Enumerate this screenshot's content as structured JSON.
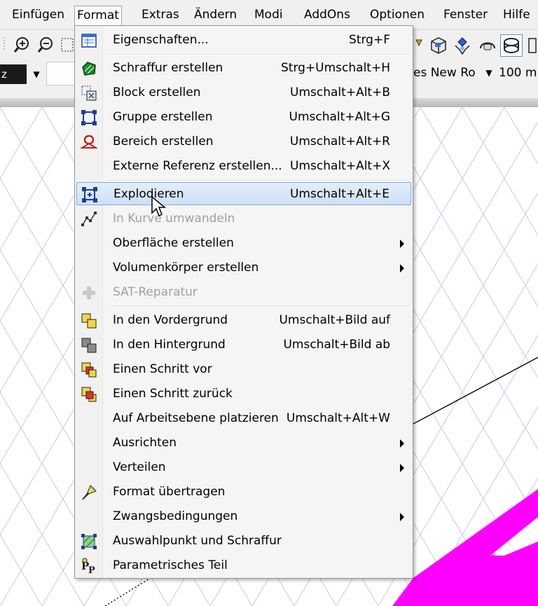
{
  "menubar": {
    "items": [
      {
        "label": "Einfügen",
        "active": false
      },
      {
        "label": "Format",
        "active": true
      },
      {
        "label": "Extras",
        "active": false
      },
      {
        "label": "Ändern",
        "active": false
      },
      {
        "label": "Modi",
        "active": false
      },
      {
        "label": "AddOns",
        "active": false
      },
      {
        "label": "Optionen",
        "active": false
      },
      {
        "label": "Fenster",
        "active": false
      },
      {
        "label": "Hilfe",
        "active": false
      }
    ]
  },
  "toolbar": {
    "layer_combo_value": "z",
    "font_combo_value": "es New Ro",
    "size_combo_value": "100 m"
  },
  "format_menu": {
    "items": [
      {
        "label": "Eigenschaften...",
        "shortcut": "Strg+F",
        "icon": "properties-icon"
      },
      {
        "separator": true
      },
      {
        "label": "Schraffur erstellen",
        "shortcut": "Strg+Umschalt+H",
        "icon": "hatch-icon"
      },
      {
        "label": "Block erstellen",
        "shortcut": "Umschalt+Alt+B",
        "icon": "block-icon"
      },
      {
        "label": "Gruppe erstellen",
        "shortcut": "Umschalt+Alt+G",
        "icon": "group-icon"
      },
      {
        "label": "Bereich erstellen",
        "shortcut": "Umschalt+Alt+R",
        "icon": "region-icon"
      },
      {
        "label": "Externe Referenz erstellen...",
        "shortcut": "Umschalt+Alt+X"
      },
      {
        "separator": true
      },
      {
        "label": "Explodieren",
        "shortcut": "Umschalt+Alt+E",
        "icon": "explode-icon",
        "highlighted": true
      },
      {
        "label": "In Kurve umwandeln",
        "icon": "curve-icon",
        "disabled": true
      },
      {
        "label": "Oberfläche erstellen",
        "submenu": true
      },
      {
        "label": "Volumenkörper erstellen",
        "submenu": true
      },
      {
        "label": "SAT-Reparatur",
        "icon": "sat-repair-icon",
        "disabled": true
      },
      {
        "separator": true
      },
      {
        "label": "In den Vordergrund",
        "shortcut": "Umschalt+Bild auf",
        "icon": "bring-to-front-icon"
      },
      {
        "label": "In den Hintergrund",
        "shortcut": "Umschalt+Bild ab",
        "icon": "send-to-back-icon"
      },
      {
        "label": "Einen Schritt vor",
        "icon": "bring-forward-icon"
      },
      {
        "label": "Einen Schritt zurück",
        "icon": "send-backward-icon"
      },
      {
        "label": "Auf Arbeitsebene platzieren",
        "shortcut": "Umschalt+Alt+W"
      },
      {
        "label": "Ausrichten",
        "submenu": true
      },
      {
        "label": "Verteilen",
        "submenu": true
      },
      {
        "label": "Format übertragen",
        "icon": "format-painter-icon"
      },
      {
        "label": "Zwangsbedingungen",
        "submenu": true
      },
      {
        "label": "Auswahlpunkt und Schraffur",
        "icon": "selection-point-hatch-icon"
      },
      {
        "label": "Parametrisches Teil",
        "icon": "parametric-part-icon"
      }
    ]
  },
  "colors": {
    "menubar_bg": "#f0f0f0",
    "menu_bg": "#f5f5f5",
    "highlight_border": "#84acdd",
    "disabled_text": "#a0a0a0",
    "magenta_shape": "#ff00ff",
    "grid_line": "#c8c8ec"
  }
}
